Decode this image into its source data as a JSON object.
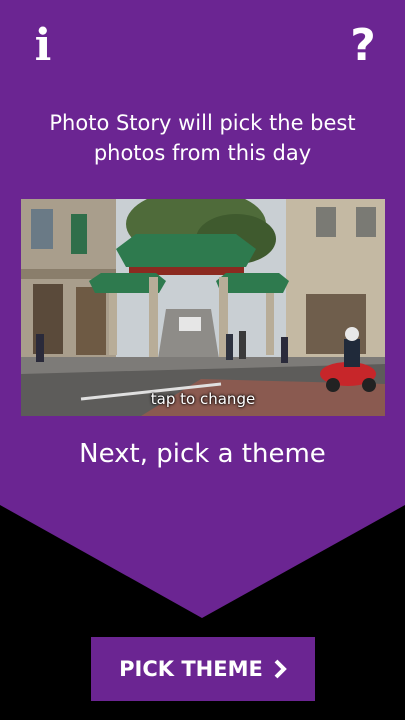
{
  "header": {
    "info_label": "i",
    "help_label": "?"
  },
  "intro": {
    "text": "Photo Story will pick the best photos from this day"
  },
  "photo": {
    "caption": "tap to change"
  },
  "next_step": {
    "text": "Next, pick a theme"
  },
  "pick_theme_button": {
    "label": "PICK THEME",
    "icon": "chevron-right-icon"
  },
  "colors": {
    "accent": "#6b2592",
    "background": "#000000"
  }
}
